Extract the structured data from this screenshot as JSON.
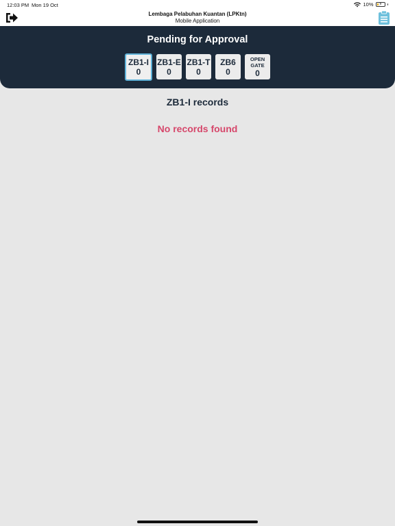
{
  "status": {
    "time": "12:03 PM",
    "date": "Mon 19 Oct",
    "battery": "10%",
    "icons": [
      "wifi-icon",
      "battery-icon"
    ]
  },
  "appbar": {
    "title": "Lembaga Pelabuhan Kuantan (LPKtn)",
    "subtitle": "Mobile Application",
    "left_icon": "logout-icon",
    "right_icon": "clipboard-icon"
  },
  "header": {
    "heading": "Pending for Approval",
    "tabs": [
      {
        "label": "ZB1-I",
        "count": "0"
      },
      {
        "label": "ZB1-E",
        "count": "0"
      },
      {
        "label": "ZB1-T",
        "count": "0"
      },
      {
        "label": "ZB6",
        "count": "0"
      },
      {
        "label_line1": "OPEN",
        "label_line2": "GATE",
        "count": "0"
      }
    ]
  },
  "main": {
    "records_title": "ZB1-I records",
    "empty_message": "No records found"
  },
  "colors": {
    "header_bg": "#1c2a3a",
    "active_tab_border": "#5fb3d9",
    "empty_text": "#d6476b",
    "page_bg": "#e7e7e7",
    "clipboard_icon": "#6ec0dc"
  }
}
